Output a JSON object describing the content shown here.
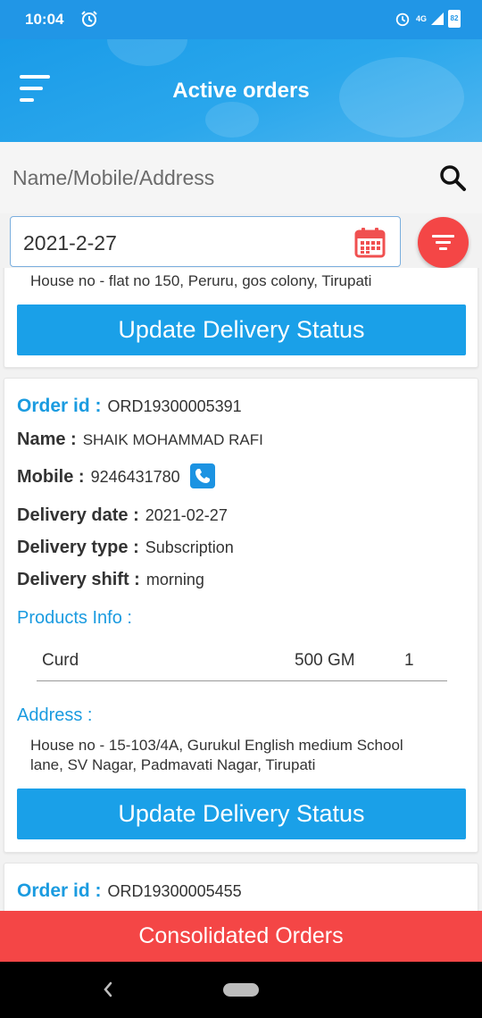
{
  "status_bar": {
    "time": "10:04",
    "network": "4G",
    "battery": "82"
  },
  "app_bar": {
    "title": "Active orders"
  },
  "search": {
    "placeholder": "Name/Mobile/Address"
  },
  "date_filter": {
    "value": "2021-2-27"
  },
  "orders": [
    {
      "address": "House no - flat no 150, Peruru, gos colony, Tirupati",
      "update_label": "Update Delivery Status"
    },
    {
      "order_id_label": "Order id :",
      "order_id": "ORD19300005391",
      "name_label": "Name :",
      "name": "SHAIK MOHAMMAD RAFI",
      "mobile_label": "Mobile :",
      "mobile": "9246431780",
      "delivery_date_label": "Delivery date :",
      "delivery_date": "2021-02-27",
      "delivery_type_label": "Delivery type :",
      "delivery_type": "Subscription",
      "delivery_shift_label": "Delivery shift :",
      "delivery_shift": "morning",
      "products_label": "Products Info :",
      "products": [
        {
          "name": "Curd",
          "size": "500 GM",
          "qty": "1"
        }
      ],
      "address_label": "Address :",
      "address_line1": "House no - 15-103/4A, Gurukul English medium School",
      "address_line2": "lane, SV Nagar, Padmavati Nagar, Tirupati",
      "update_label": "Update Delivery Status"
    },
    {
      "order_id_label": "Order id :",
      "order_id": "ORD19300005455"
    }
  ],
  "bottom_button": {
    "label": "Consolidated Orders"
  },
  "colors": {
    "primary": "#1aa0e8",
    "accent": "#f44646",
    "label_blue": "#1a9be0"
  }
}
